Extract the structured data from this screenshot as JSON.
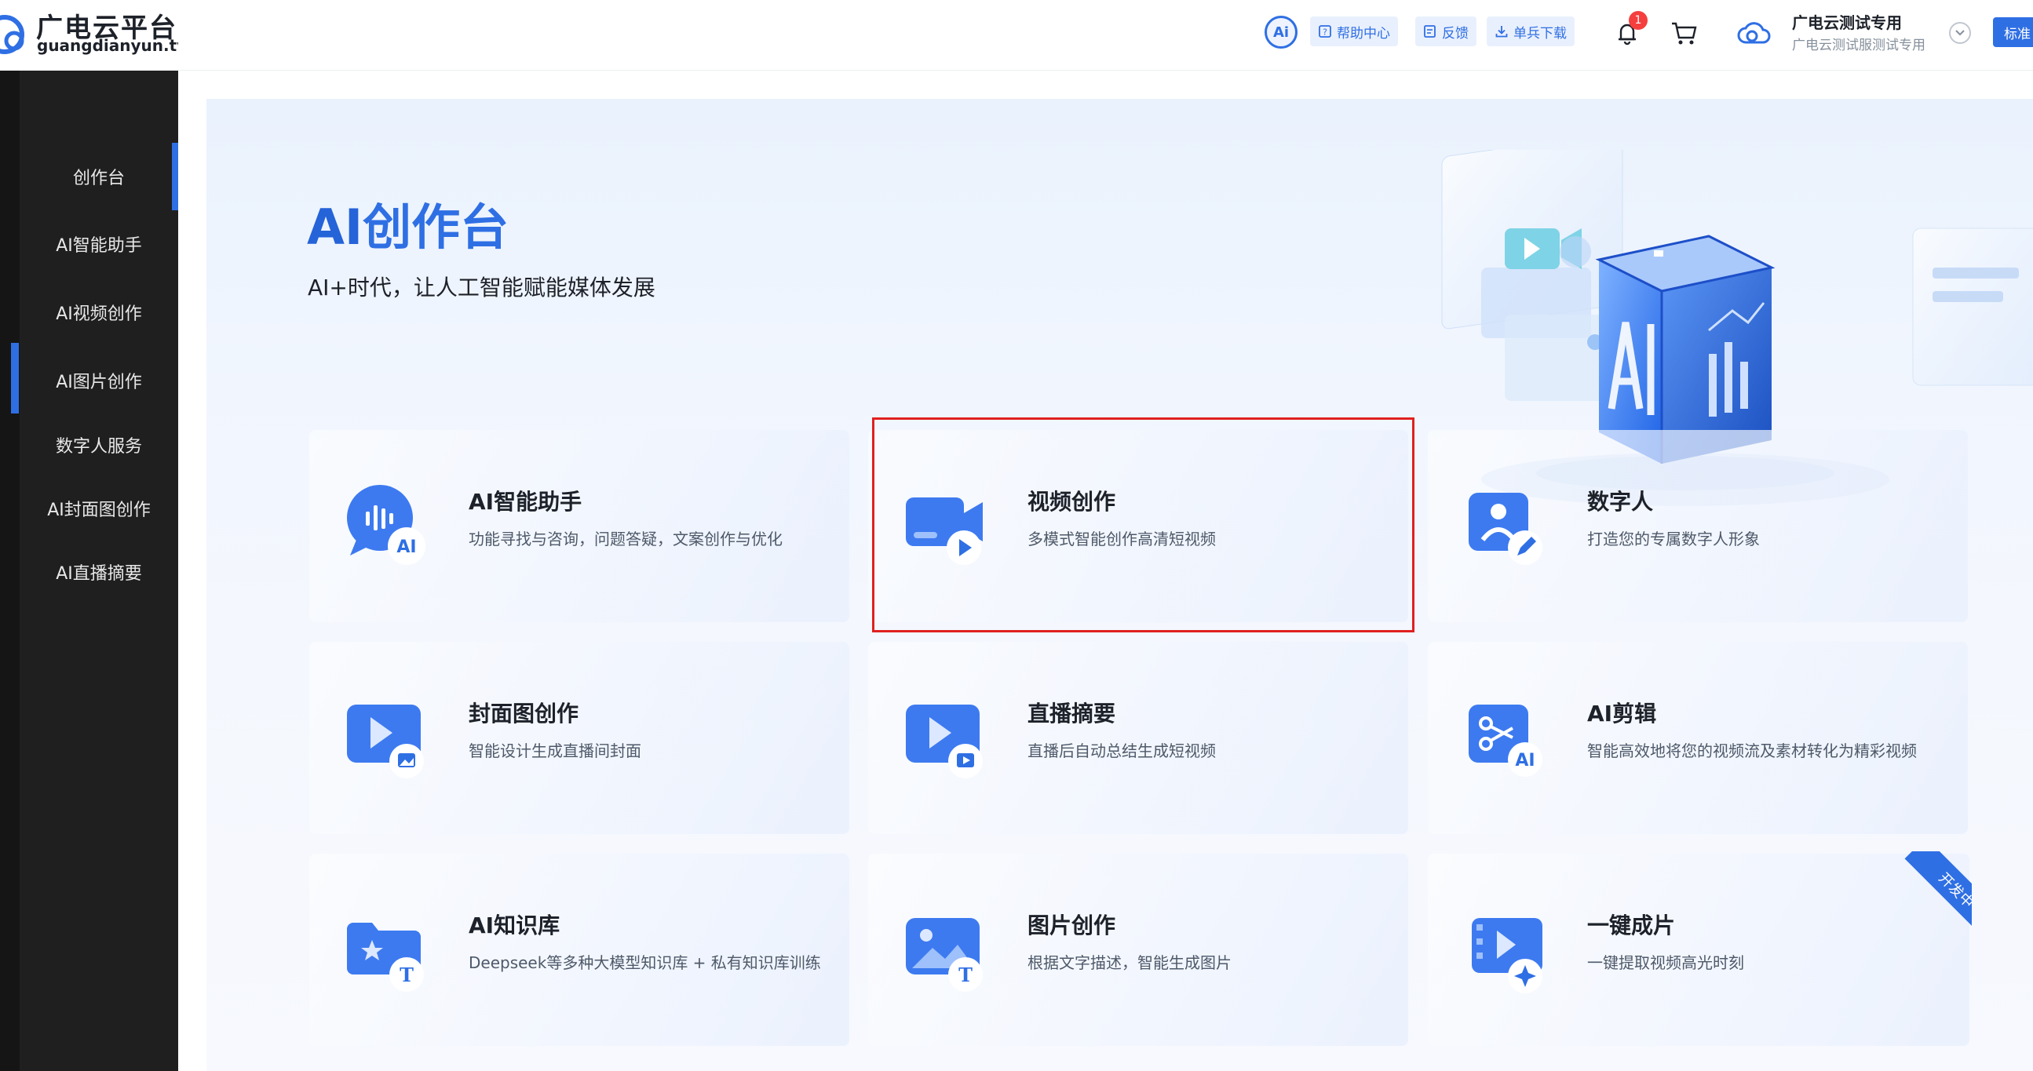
{
  "logo": {
    "name": "广电云平台",
    "domain": "guangdianyun.tv"
  },
  "sidebar": {
    "items": [
      {
        "label": "创作台"
      },
      {
        "label": "AI智能助手"
      },
      {
        "label": "AI视频创作"
      },
      {
        "label": "AI图片创作"
      },
      {
        "label": "数字人服务"
      },
      {
        "label": "AI封面图创作"
      },
      {
        "label": "AI直播摘要"
      }
    ]
  },
  "header": {
    "ai_badge": "Ai",
    "help": "帮助中心",
    "feedback": "反馈",
    "download": "单兵下载",
    "notification_count": "1",
    "account_name": "广电云测试专用",
    "account_sub": "广电云测试服测试专用",
    "std_button": "标准"
  },
  "hero": {
    "title_ai": "AI",
    "title_rest": "创作台",
    "subtitle": "AI+时代，让人工智能赋能媒体发展"
  },
  "cards": [
    {
      "title": "AI智能助手",
      "desc": "功能寻找与咨询，问题答疑，文案创作与优化",
      "icon": "ai-assistant-icon"
    },
    {
      "title": "视频创作",
      "desc": "多模式智能创作高清短视频",
      "icon": "video-creation-icon"
    },
    {
      "title": "数字人",
      "desc": "打造您的专属数字人形象",
      "icon": "digital-human-icon"
    },
    {
      "title": "封面图创作",
      "desc": "智能设计生成直播间封面",
      "icon": "cover-image-icon"
    },
    {
      "title": "直播摘要",
      "desc": "直播后自动总结生成短视频",
      "icon": "live-summary-icon"
    },
    {
      "title": "AI剪辑",
      "desc": "智能高效地将您的视频流及素材转化为精彩视频",
      "icon": "ai-edit-icon"
    },
    {
      "title": "AI知识库",
      "desc": "Deepseek等多种大模型知识库 + 私有知识库训练",
      "icon": "knowledge-base-icon"
    },
    {
      "title": "图片创作",
      "desc": "根据文字描述，智能生成图片",
      "icon": "image-creation-icon"
    },
    {
      "title": "一键成片",
      "desc": "一键提取视频高光时刻",
      "icon": "one-click-video-icon",
      "ribbon": "开发中"
    }
  ],
  "colors": {
    "accent": "#2f6fe4",
    "sidebar_bg": "#1f1f1f",
    "highlight_border": "#e02020"
  }
}
